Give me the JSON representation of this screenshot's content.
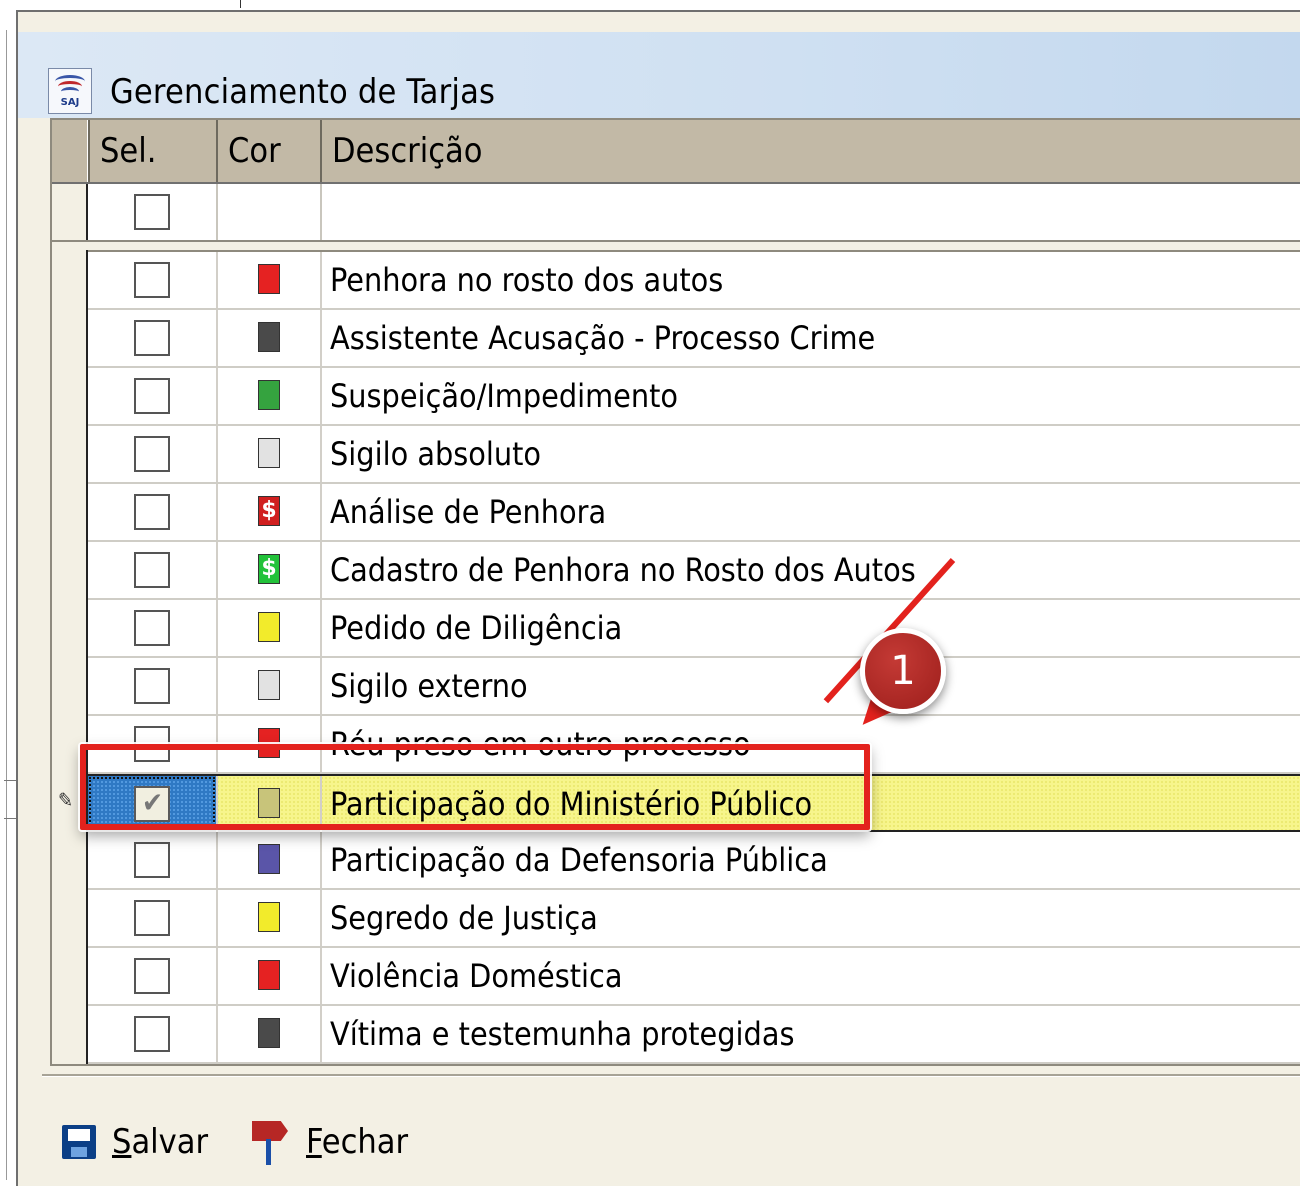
{
  "window": {
    "title": "Gerenciamento de Tarjas",
    "icon": "saj-app-icon",
    "icon_text": "SAJ"
  },
  "grid": {
    "columns": {
      "sel": "Sel.",
      "cor": "Cor",
      "descricao": "Descrição"
    },
    "rows": [
      {
        "description": "Penhora no rosto dos autos",
        "color": "#e52222",
        "icon": null,
        "checked": false
      },
      {
        "description": "Assistente Acusação - Processo Crime",
        "color": "#4a4a4a",
        "icon": null,
        "checked": false
      },
      {
        "description": "Suspeição/Impedimento",
        "color": "#35a33f",
        "icon": null,
        "checked": false
      },
      {
        "description": "Sigilo absoluto",
        "color": "#e2e2e2",
        "icon": null,
        "checked": false
      },
      {
        "description": "Análise de Penhora",
        "color": "#d01f1f",
        "icon": "dollar",
        "checked": false
      },
      {
        "description": "Cadastro de Penhora no Rosto dos Autos",
        "color": "#22c23a",
        "icon": "dollar",
        "checked": false
      },
      {
        "description": "Pedido de Diligência",
        "color": "#f2eb2b",
        "icon": null,
        "checked": false
      },
      {
        "description": "Sigilo externo",
        "color": "#e2e2e2",
        "icon": null,
        "checked": false
      },
      {
        "description": "Réu preso em outro processo",
        "color": "#e52222",
        "icon": null,
        "checked": false
      },
      {
        "description": "Participação do Ministério Público",
        "color": "#c8c47a",
        "icon": null,
        "checked": true,
        "selected": true
      },
      {
        "description": "Participação da Defensoria Pública",
        "color": "#5a55a8",
        "icon": null,
        "checked": false
      },
      {
        "description": "Segredo de Justiça",
        "color": "#f2eb2b",
        "icon": null,
        "checked": false
      },
      {
        "description": "Violência Doméstica",
        "color": "#e52222",
        "icon": null,
        "checked": false
      },
      {
        "description": "Vítima e testemunha protegidas",
        "color": "#4a4a4a",
        "icon": null,
        "checked": false
      }
    ]
  },
  "annotation": {
    "step_number": "1",
    "color": "#e3221d"
  },
  "toolbar": {
    "save_label": "Salvar",
    "close_label": "Fechar"
  },
  "symbols": {
    "dollar": "$",
    "check": "✔",
    "edit": "✎"
  }
}
